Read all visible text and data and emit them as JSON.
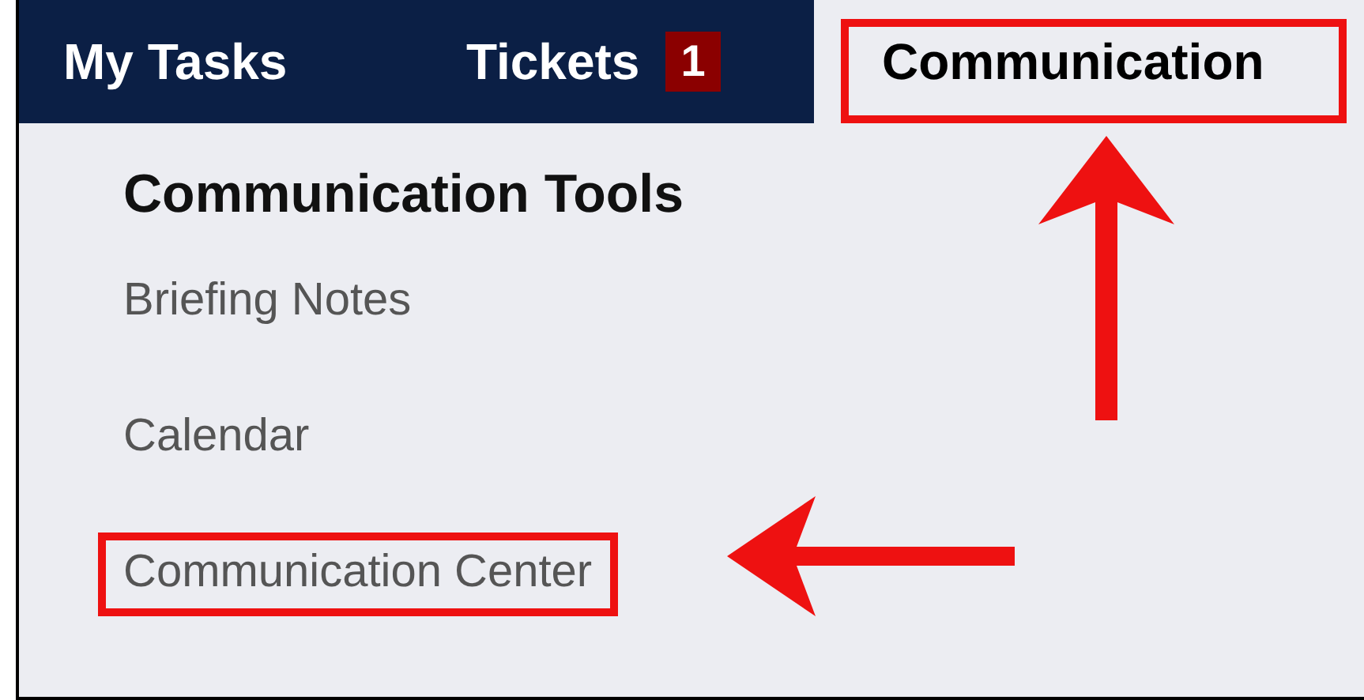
{
  "nav": {
    "tabs": [
      {
        "label": "My Tasks",
        "selected": false
      },
      {
        "label": "Tickets",
        "selected": false,
        "badge": "1"
      },
      {
        "label": "Communication",
        "selected": true,
        "highlighted": true
      }
    ]
  },
  "menu": {
    "title": "Communication Tools",
    "items": [
      {
        "label": "Briefing Notes",
        "highlighted": false
      },
      {
        "label": "Calendar",
        "highlighted": false
      },
      {
        "label": "Communication Center",
        "highlighted": true
      }
    ]
  }
}
